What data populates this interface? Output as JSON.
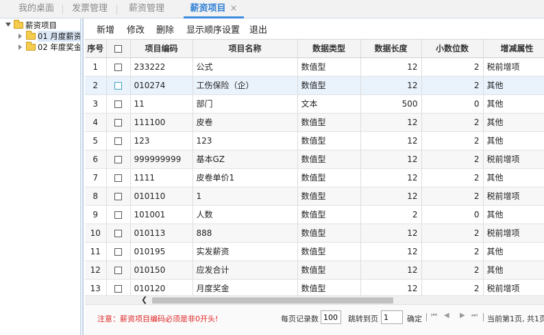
{
  "tabs": [
    {
      "label": "我的桌面"
    },
    {
      "label": "发票管理"
    },
    {
      "label": "薪资管理"
    },
    {
      "label": "薪资项目",
      "close": "×"
    }
  ],
  "tree": {
    "root": "薪资项目",
    "children": [
      {
        "label": "01 月度薪资"
      },
      {
        "label": "02 年度奖金"
      }
    ]
  },
  "toolbar": {
    "add": "新增",
    "edit": "修改",
    "delete": "删除",
    "order": "显示顺序设置",
    "exit": "退出"
  },
  "table": {
    "headers": [
      "序号",
      "",
      "项目编码",
      "项目名称",
      "数据类型",
      "数据长度",
      "小数位数",
      "增减属性"
    ],
    "rows": [
      [
        "1",
        "233222",
        "公式",
        "数值型",
        "12",
        "2",
        "税前增项"
      ],
      [
        "2",
        "010274",
        "工伤保险（企）",
        "数值型",
        "12",
        "2",
        "其他"
      ],
      [
        "3",
        "11",
        "部门",
        "文本",
        "500",
        "0",
        "其他"
      ],
      [
        "4",
        "111100",
        "皮卷",
        "数值型",
        "12",
        "2",
        "其他"
      ],
      [
        "5",
        "123",
        "123",
        "数值型",
        "12",
        "2",
        "其他"
      ],
      [
        "6",
        "999999999",
        "基本GZ",
        "数值型",
        "12",
        "2",
        "税前增项"
      ],
      [
        "7",
        "1111",
        "皮卷单价1",
        "数值型",
        "12",
        "2",
        "其他"
      ],
      [
        "8",
        "010110",
        "1",
        "数值型",
        "12",
        "2",
        "税前增项"
      ],
      [
        "9",
        "101001",
        "人数",
        "数值型",
        "2",
        "0",
        "其他"
      ],
      [
        "10",
        "010113",
        "888",
        "数值型",
        "12",
        "2",
        "税前增项"
      ],
      [
        "11",
        "010195",
        "实发薪资",
        "数值型",
        "12",
        "2",
        "其他"
      ],
      [
        "12",
        "010150",
        "应发合计",
        "数值型",
        "12",
        "2",
        "其他"
      ],
      [
        "13",
        "010120",
        "月度奖金",
        "数值型",
        "12",
        "2",
        "税前增项"
      ]
    ],
    "highlight_row": 2
  },
  "footer": {
    "note": "注意：薪资项目编码必须是非0开头!",
    "page_size_label": "每页记录数",
    "page_size": "100",
    "jump_label": "跳转到页",
    "jump_value": "1",
    "confirm": "确定",
    "page_info": "当前第1页, 共1页"
  }
}
